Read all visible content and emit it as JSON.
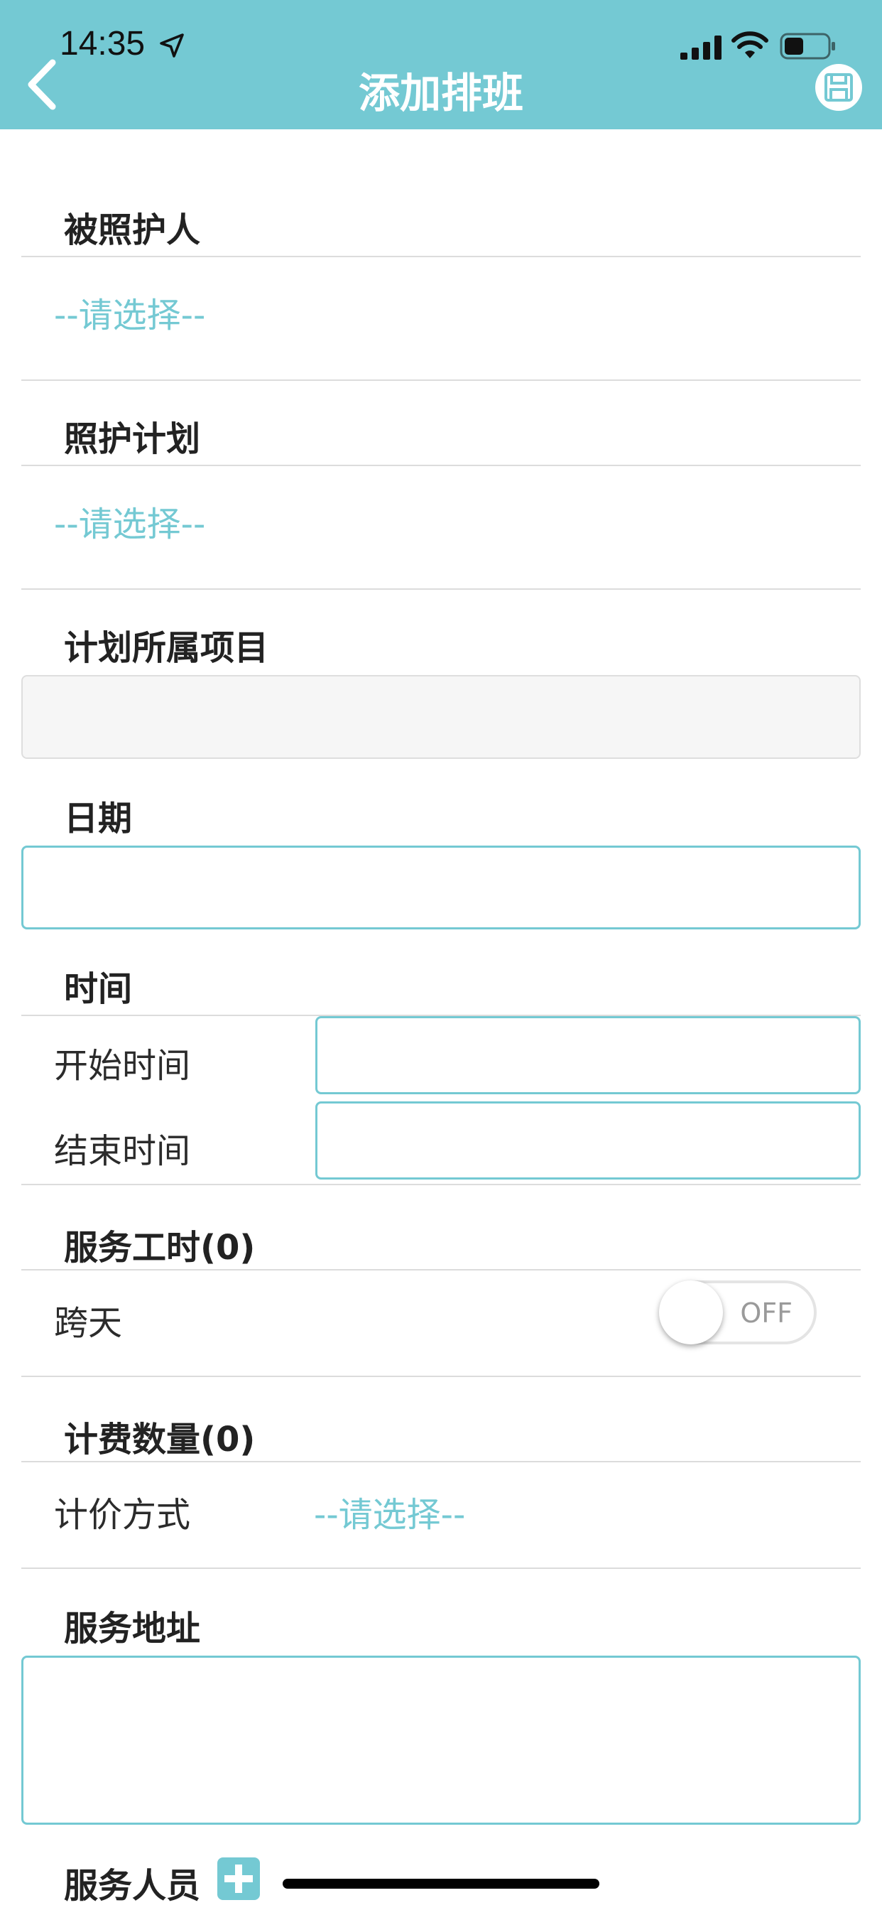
{
  "status_bar": {
    "time": "14:35"
  },
  "header": {
    "title": "添加排班"
  },
  "form": {
    "care_recipient": {
      "label": "被照护人",
      "value": "--请选择--"
    },
    "care_plan": {
      "label": "照护计划",
      "value": "--请选择--"
    },
    "plan_project": {
      "label": "计划所属项目",
      "value": ""
    },
    "date": {
      "label": "日期",
      "value": ""
    },
    "time": {
      "label": "时间",
      "start_label": "开始时间",
      "start_value": "",
      "end_label": "结束时间",
      "end_value": ""
    },
    "service_hours": {
      "label": "服务工时(0)",
      "cross_day_label": "跨天",
      "cross_day_state": "OFF"
    },
    "billing_quantity": {
      "label": "计费数量(0)",
      "pricing_method_label": "计价方式",
      "pricing_method_value": "--请选择--"
    },
    "service_address": {
      "label": "服务地址",
      "value": ""
    },
    "service_staff": {
      "label": "服务人员"
    }
  },
  "colors": {
    "accent": "#74c9d3",
    "header_bg": "#74c9d3"
  },
  "icons": [
    "location-arrow-icon",
    "signal-icon",
    "wifi-icon",
    "battery-icon",
    "back-icon",
    "save-icon",
    "plus-icon"
  ]
}
